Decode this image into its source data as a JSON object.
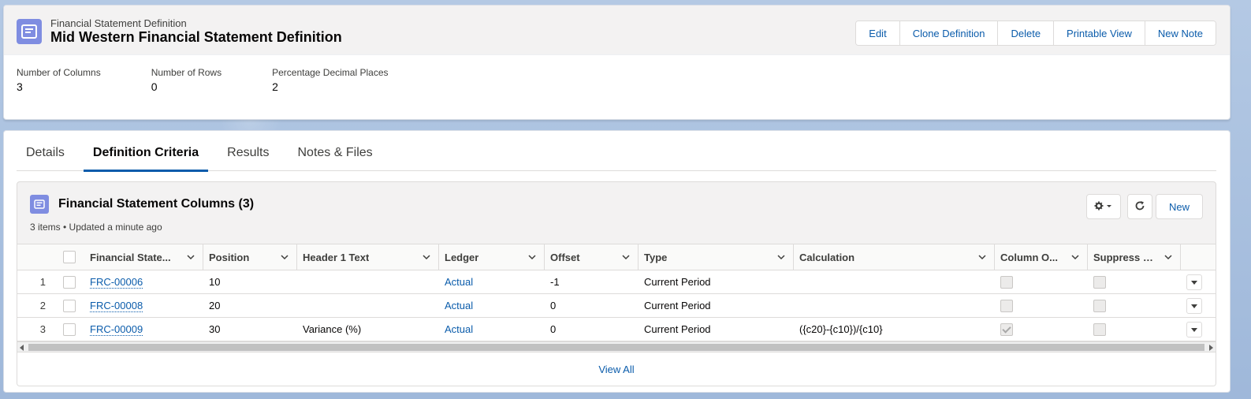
{
  "colors": {
    "accent": "#0b5cab",
    "record_icon": "#7f8de1",
    "header_bg": "#f3f2f2"
  },
  "header": {
    "object_name": "Financial Statement Definition",
    "record_title": "Mid Western Financial Statement Definition",
    "icon": "record-card-icon",
    "actions": [
      "Edit",
      "Clone Definition",
      "Delete",
      "Printable View",
      "New Note"
    ]
  },
  "highlights": {
    "fields": [
      {
        "label": "Number of Columns",
        "value": "3"
      },
      {
        "label": "Number of Rows",
        "value": "0"
      },
      {
        "label": "Percentage Decimal Places",
        "value": "2"
      }
    ]
  },
  "tabs": [
    {
      "label": "Details",
      "active": false
    },
    {
      "label": "Definition Criteria",
      "active": true
    },
    {
      "label": "Results",
      "active": false
    },
    {
      "label": "Notes & Files",
      "active": false
    }
  ],
  "related_list": {
    "title": "Financial Statement Columns (3)",
    "subtitle": "3 items • Updated a minute ago",
    "icons": {
      "settings": "gear-icon",
      "refresh": "refresh-icon"
    },
    "new_label": "New",
    "columns": [
      "Financial State...",
      "Position",
      "Header 1 Text",
      "Ledger",
      "Offset",
      "Type",
      "Calculation",
      "Column O...",
      "Suppress P..."
    ],
    "rows": [
      {
        "num": "1",
        "name": "FRC-00006",
        "position": "10",
        "header1": "",
        "ledger": "Actual",
        "offset": "-1",
        "type": "Current Period",
        "calculation": "",
        "column_o": false,
        "suppress_p": false
      },
      {
        "num": "2",
        "name": "FRC-00008",
        "position": "20",
        "header1": "",
        "ledger": "Actual",
        "offset": "0",
        "type": "Current Period",
        "calculation": "",
        "column_o": false,
        "suppress_p": false
      },
      {
        "num": "3",
        "name": "FRC-00009",
        "position": "30",
        "header1": "Variance (%)",
        "ledger": "Actual",
        "offset": "0",
        "type": "Current Period",
        "calculation": "({c20}-{c10})/{c10}",
        "column_o": true,
        "suppress_p": false
      }
    ],
    "view_all": "View All"
  }
}
